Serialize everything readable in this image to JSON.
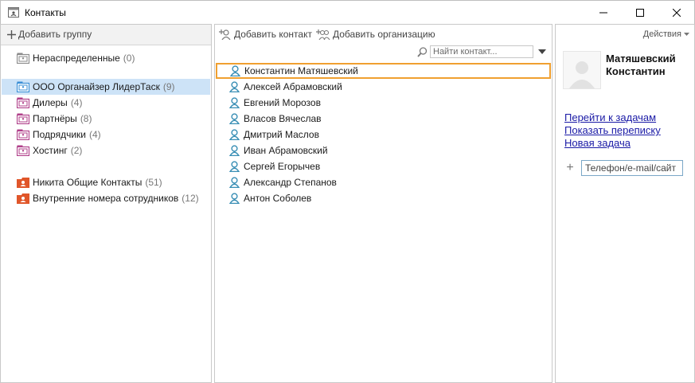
{
  "window": {
    "title": "Контакты",
    "app_icon": "contacts-app-icon"
  },
  "left": {
    "add_group_label": "Добавить группу",
    "groups": [
      {
        "label": "Нераспределенные",
        "count": "(0)",
        "icon": "unsorted-folder-icon",
        "color": "#8a8a8a"
      },
      {
        "label": "ООО Органайзер ЛидерТаск",
        "count": "(9)",
        "icon": "group-folder-icon",
        "color": "#3a8fd6",
        "selected": true
      },
      {
        "label": "Дилеры",
        "count": "(4)",
        "icon": "subgroup-folder-icon",
        "color": "#b0408a"
      },
      {
        "label": "Партнёры",
        "count": "(8)",
        "icon": "subgroup-folder-icon",
        "color": "#b0408a"
      },
      {
        "label": "Подрядчики",
        "count": "(4)",
        "icon": "subgroup-folder-icon",
        "color": "#b0408a"
      },
      {
        "label": "Хостинг",
        "count": "(2)",
        "icon": "subgroup-folder-icon",
        "color": "#b0408a"
      },
      {
        "label": "Никита Общие Контакты",
        "count": "(51)",
        "icon": "shared-folder-icon",
        "color": "#e0562a"
      },
      {
        "label": "Внутренние номера сотрудников",
        "count": "(12)",
        "icon": "shared-folder-icon",
        "color": "#e0562a"
      }
    ]
  },
  "middle": {
    "add_contact_label": "Добавить контакт",
    "add_org_label": "Добавить организацию",
    "search_placeholder": "Найти контакт...",
    "contacts": [
      "Константин Матяшевский",
      "Алексей Абрамовский",
      "Евгений Морозов",
      "Власов Вячеслав",
      "Дмитрий Маслов",
      "Иван Абрамовский",
      "Сергей Егорычев",
      "Александр Степанов",
      "Антон Соболев"
    ]
  },
  "right": {
    "actions_label": "Действия",
    "contact_name": "Матяшевский Константин",
    "links": {
      "goto_tasks": "Перейти к задачам",
      "show_correspondence": "Показать переписку",
      "new_task": "Новая задача"
    },
    "field_placeholder": "Телефон/e-mail/сайт"
  },
  "colors": {
    "selection": "#cde3f7",
    "focus_outline": "#f0a030",
    "link": "#1a1aa6",
    "contact_icon": "#3a8fb5"
  }
}
